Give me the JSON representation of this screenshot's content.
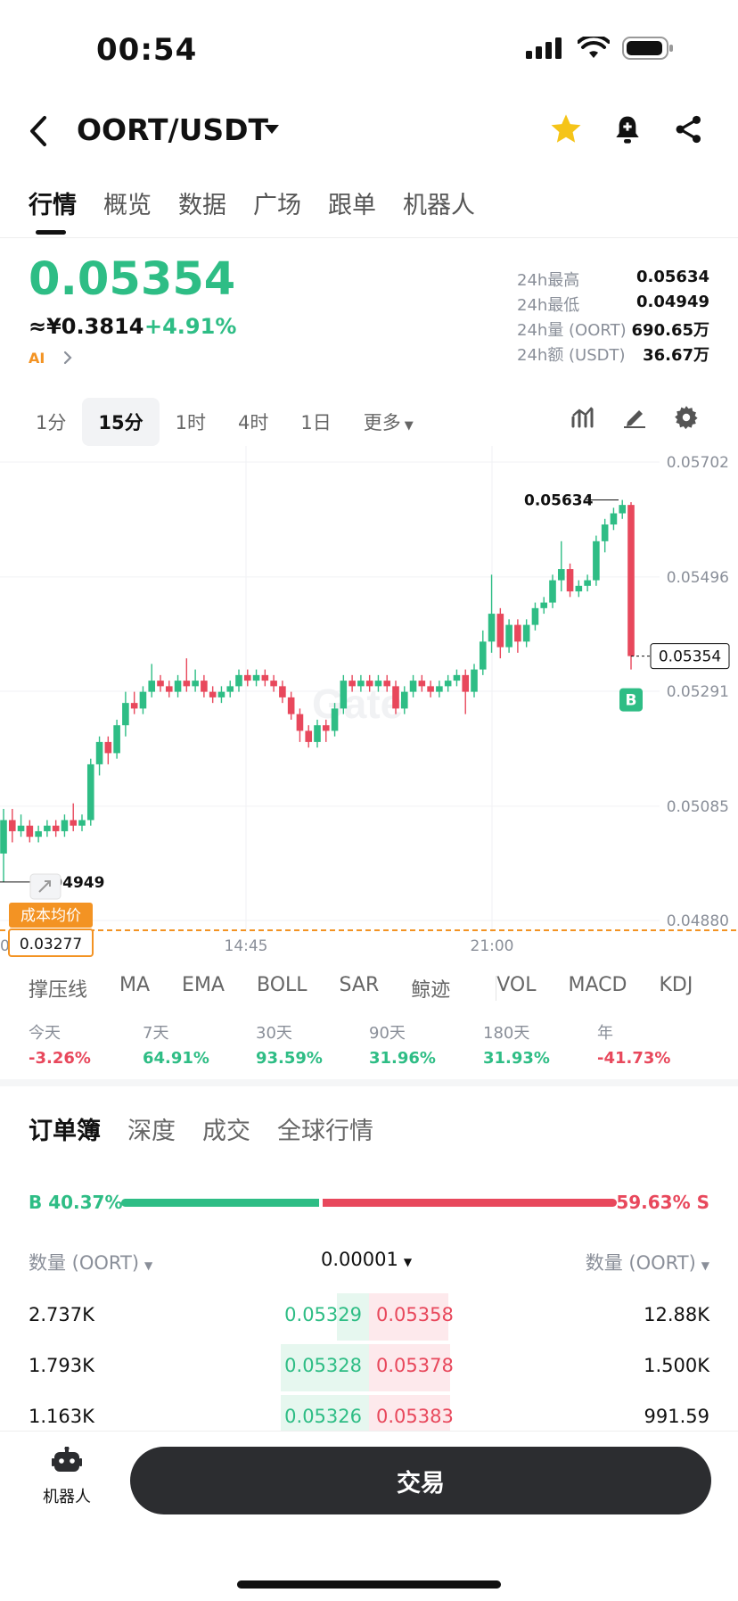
{
  "status_bar": {
    "time": "00:54"
  },
  "header": {
    "pair": "OORT/USDT"
  },
  "tabs": [
    {
      "label": "行情",
      "active": true
    },
    {
      "label": "概览"
    },
    {
      "label": "数据"
    },
    {
      "label": "广场"
    },
    {
      "label": "跟单"
    },
    {
      "label": "机器人"
    }
  ],
  "price": {
    "last": "0.05354",
    "cny": "≈¥0.3814",
    "change": "+4.91%",
    "ai_label": "AI"
  },
  "stats": [
    {
      "label": "24h最高",
      "value": "0.05634"
    },
    {
      "label": "24h最低",
      "value": "0.04949"
    },
    {
      "label": "24h量 (OORT)",
      "value": "690.65万"
    },
    {
      "label": "24h额 (USDT)",
      "value": "36.67万"
    }
  ],
  "intervals": [
    {
      "label": "1分"
    },
    {
      "label": "15分",
      "active": true
    },
    {
      "label": "1时"
    },
    {
      "label": "4时"
    },
    {
      "label": "1日"
    },
    {
      "label": "更多"
    }
  ],
  "chart": {
    "y_ticks": [
      "0.05702",
      "0.05496",
      "0.05291",
      "0.05085",
      "0.04880"
    ],
    "x_ticks": [
      "14:45",
      "21:00"
    ],
    "x_tick_leading": "0",
    "high_label": "0.05634",
    "low_label": "0.04949",
    "last_label": "0.05354",
    "buy_marker": "B",
    "cost_avg_label": "成本均价",
    "cost_avg_value": "0.03277",
    "watermark": "Gate"
  },
  "chart_data": {
    "type": "candlestick",
    "interval": "15分",
    "ylim": [
      0.0488,
      0.05702
    ],
    "y_ticks": [
      0.05702,
      0.05496,
      0.05291,
      0.05085,
      0.0488
    ],
    "x_ticks": [
      "14:45",
      "21:00"
    ],
    "high": 0.05634,
    "low": 0.04949,
    "last": 0.05354,
    "cost_avg": 0.03277,
    "candles": [
      [
        0.05,
        0.0506,
        0.04949,
        0.0508
      ],
      [
        0.0506,
        0.0504,
        0.0502,
        0.0508
      ],
      [
        0.0504,
        0.0505,
        0.0503,
        0.0507
      ],
      [
        0.0505,
        0.0503,
        0.0502,
        0.0506
      ],
      [
        0.0503,
        0.0504,
        0.0502,
        0.0505
      ],
      [
        0.0504,
        0.0505,
        0.0503,
        0.0506
      ],
      [
        0.0505,
        0.0504,
        0.0503,
        0.0506
      ],
      [
        0.0504,
        0.0506,
        0.0503,
        0.0507
      ],
      [
        0.0506,
        0.0505,
        0.0504,
        0.0509
      ],
      [
        0.0505,
        0.0506,
        0.0504,
        0.0507
      ],
      [
        0.0506,
        0.0516,
        0.0505,
        0.0517
      ],
      [
        0.0516,
        0.052,
        0.0514,
        0.0521
      ],
      [
        0.052,
        0.0518,
        0.0516,
        0.0521
      ],
      [
        0.0518,
        0.0523,
        0.0517,
        0.0524
      ],
      [
        0.0523,
        0.0527,
        0.0521,
        0.0529
      ],
      [
        0.0527,
        0.0526,
        0.0525,
        0.0529
      ],
      [
        0.0526,
        0.0529,
        0.0525,
        0.053
      ],
      [
        0.0529,
        0.0531,
        0.0528,
        0.0534
      ],
      [
        0.0531,
        0.053,
        0.0529,
        0.0532
      ],
      [
        0.053,
        0.0529,
        0.0528,
        0.0531
      ],
      [
        0.0529,
        0.0531,
        0.0528,
        0.0532
      ],
      [
        0.0531,
        0.053,
        0.0529,
        0.0535
      ],
      [
        0.053,
        0.0531,
        0.0529,
        0.0533
      ],
      [
        0.0531,
        0.0529,
        0.0528,
        0.0532
      ],
      [
        0.0529,
        0.0528,
        0.0527,
        0.053
      ],
      [
        0.0528,
        0.0529,
        0.0527,
        0.053
      ],
      [
        0.0529,
        0.053,
        0.0528,
        0.0531
      ],
      [
        0.053,
        0.0532,
        0.0529,
        0.0533
      ],
      [
        0.0532,
        0.0531,
        0.053,
        0.0533
      ],
      [
        0.0531,
        0.0532,
        0.053,
        0.0533
      ],
      [
        0.0532,
        0.0531,
        0.053,
        0.0533
      ],
      [
        0.0531,
        0.053,
        0.0529,
        0.0532
      ],
      [
        0.053,
        0.0528,
        0.0527,
        0.0531
      ],
      [
        0.0528,
        0.0525,
        0.0524,
        0.0529
      ],
      [
        0.0525,
        0.0522,
        0.052,
        0.0526
      ],
      [
        0.0522,
        0.052,
        0.0519,
        0.0523
      ],
      [
        0.052,
        0.0523,
        0.0519,
        0.0524
      ],
      [
        0.0523,
        0.0522,
        0.052,
        0.0524
      ],
      [
        0.0522,
        0.0526,
        0.0521,
        0.0527
      ],
      [
        0.0526,
        0.0531,
        0.0525,
        0.0532
      ],
      [
        0.0531,
        0.053,
        0.0529,
        0.0532
      ],
      [
        0.053,
        0.0531,
        0.0529,
        0.0532
      ],
      [
        0.0531,
        0.053,
        0.0529,
        0.0532
      ],
      [
        0.053,
        0.0531,
        0.0529,
        0.0532
      ],
      [
        0.0531,
        0.053,
        0.0529,
        0.0532
      ],
      [
        0.053,
        0.0526,
        0.0525,
        0.0531
      ],
      [
        0.0526,
        0.0529,
        0.0525,
        0.053
      ],
      [
        0.0529,
        0.0531,
        0.0528,
        0.0532
      ],
      [
        0.0531,
        0.053,
        0.0529,
        0.0532
      ],
      [
        0.053,
        0.0529,
        0.0528,
        0.0531
      ],
      [
        0.0529,
        0.053,
        0.0528,
        0.0531
      ],
      [
        0.053,
        0.0531,
        0.0529,
        0.0532
      ],
      [
        0.0531,
        0.0532,
        0.053,
        0.0533
      ],
      [
        0.0532,
        0.0529,
        0.0525,
        0.0533
      ],
      [
        0.0529,
        0.0533,
        0.0528,
        0.0534
      ],
      [
        0.0533,
        0.0538,
        0.0532,
        0.054
      ],
      [
        0.0538,
        0.0543,
        0.0536,
        0.055
      ],
      [
        0.0543,
        0.0537,
        0.0535,
        0.0544
      ],
      [
        0.0537,
        0.0541,
        0.0536,
        0.0542
      ],
      [
        0.0541,
        0.0538,
        0.0536,
        0.0542
      ],
      [
        0.0538,
        0.0541,
        0.0537,
        0.0542
      ],
      [
        0.0541,
        0.0544,
        0.054,
        0.0545
      ],
      [
        0.0544,
        0.0545,
        0.0543,
        0.0546
      ],
      [
        0.0545,
        0.0549,
        0.0544,
        0.055
      ],
      [
        0.0549,
        0.0551,
        0.0547,
        0.0556
      ],
      [
        0.0551,
        0.0547,
        0.0546,
        0.0552
      ],
      [
        0.0547,
        0.0548,
        0.0546,
        0.0549
      ],
      [
        0.0548,
        0.0549,
        0.0547,
        0.055
      ],
      [
        0.0549,
        0.0556,
        0.0548,
        0.0557
      ],
      [
        0.0556,
        0.0559,
        0.0554,
        0.056
      ],
      [
        0.0559,
        0.0561,
        0.0558,
        0.0562
      ],
      [
        0.0561,
        0.05625,
        0.056,
        0.05634
      ],
      [
        0.05625,
        0.05354,
        0.0533,
        0.0563
      ]
    ]
  },
  "indicators": [
    "撑压线",
    "MA",
    "EMA",
    "BOLL",
    "SAR",
    "鲸迹",
    "VOL",
    "MACD",
    "KDJ"
  ],
  "performance": [
    {
      "label": "今天",
      "value": "-3.26%",
      "trend": "down"
    },
    {
      "label": "7天",
      "value": "64.91%",
      "trend": "up"
    },
    {
      "label": "30天",
      "value": "93.59%",
      "trend": "up"
    },
    {
      "label": "90天",
      "value": "31.96%",
      "trend": "up"
    },
    {
      "label": "180天",
      "value": "31.93%",
      "trend": "up"
    },
    {
      "label": "年",
      "value": "-41.73%",
      "trend": "down"
    }
  ],
  "orderbook": {
    "tabs": [
      {
        "label": "订单簿",
        "active": true
      },
      {
        "label": "深度"
      },
      {
        "label": "成交"
      },
      {
        "label": "全球行情"
      }
    ],
    "buy_ratio_label": "B 40.37%",
    "sell_ratio_label": "59.63% S",
    "buy_ratio": 0.4037,
    "left_header": "数量 (OORT)",
    "precision": "0.00001",
    "right_header": "数量 (OORT)",
    "rows": [
      {
        "bid_qty": "2.737K",
        "bid_price": "0.05329",
        "ask_price": "0.05358",
        "ask_qty": "12.88K",
        "bid_depth": 0.12,
        "ask_depth": 0.35
      },
      {
        "bid_qty": "1.793K",
        "bid_price": "0.05328",
        "ask_price": "0.05378",
        "ask_qty": "1.500K",
        "bid_depth": 0.33,
        "ask_depth": 0.36
      },
      {
        "bid_qty": "1.163K",
        "bid_price": "0.05326",
        "ask_price": "0.05383",
        "ask_qty": "991.59",
        "bid_depth": 0.33,
        "ask_depth": 0.36
      }
    ]
  },
  "bottom": {
    "robot_label": "机器人",
    "trade_label": "交易"
  }
}
